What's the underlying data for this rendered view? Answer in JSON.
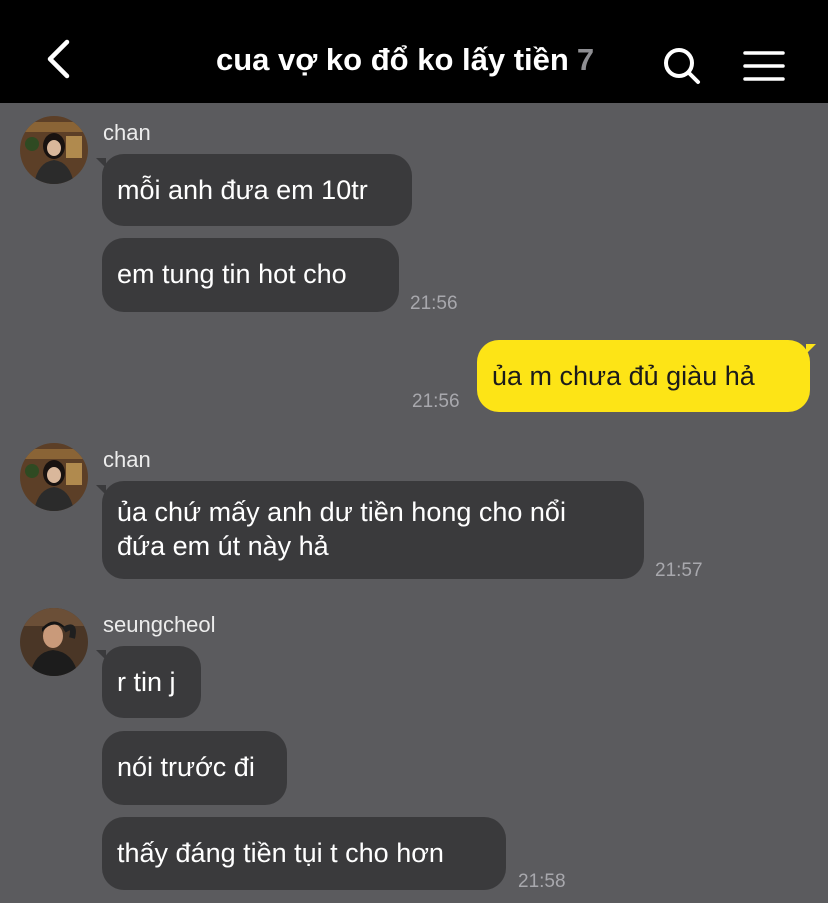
{
  "header": {
    "title": "cua vợ ko đổ ko lấy tiền",
    "member_count": "7",
    "back_icon": "chevron-left-icon",
    "search_icon": "search-icon",
    "menu_icon": "hamburger-menu-icon"
  },
  "colors": {
    "background": "#5b5b5e",
    "header": "#000000",
    "incoming_bubble": "#3a3a3c",
    "outgoing_bubble": "#fde416",
    "timestamp": "#a8a8ad"
  },
  "messages": [
    {
      "sender": "chan",
      "avatar_icon": "user-avatar",
      "bubbles": [
        "mỗi anh đưa em 10tr",
        "em tung tin hot cho"
      ],
      "time": "21:56"
    },
    {
      "sender": "me",
      "bubbles": [
        "ủa m chưa đủ giàu hả"
      ],
      "time": "21:56"
    },
    {
      "sender": "chan",
      "avatar_icon": "user-avatar",
      "bubbles": [
        "ủa chứ mấy anh dư tiền hong cho nổi",
        "đứa em út này hả"
      ],
      "time": "21:57"
    },
    {
      "sender": "seungcheol",
      "avatar_icon": "user-avatar",
      "bubbles": [
        "r tin j",
        "nói trước đi",
        "thấy đáng tiền tụi t cho hơn"
      ],
      "time": "21:58"
    }
  ]
}
